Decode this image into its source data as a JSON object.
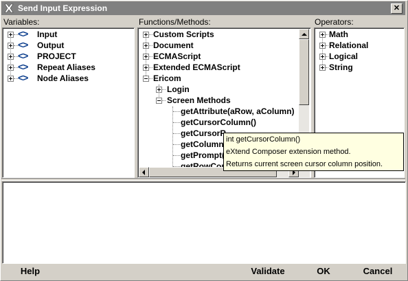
{
  "window": {
    "title": "Send Input Expression",
    "close_label": "✕"
  },
  "variables": {
    "label": "Variables:",
    "items": [
      {
        "icon": "<>",
        "label": "Input"
      },
      {
        "icon": "<>",
        "label": "Output"
      },
      {
        "icon": "<>",
        "label": "PROJECT"
      },
      {
        "icon": "<>",
        "label": "Repeat Aliases"
      },
      {
        "icon": "<>",
        "label": "Node Aliases"
      }
    ]
  },
  "functions": {
    "label": "Functions/Methods:",
    "items": [
      {
        "label": "Custom Scripts",
        "expanded": false
      },
      {
        "label": "Document",
        "expanded": false
      },
      {
        "label": "ECMAScript",
        "expanded": false
      },
      {
        "label": "Extended ECMAScript",
        "expanded": false
      },
      {
        "label": "Ericom",
        "expanded": true
      },
      {
        "label": "Login",
        "expanded": false
      },
      {
        "label": "Screen Methods",
        "expanded": true
      }
    ],
    "methods": [
      "getAttribute(aRow, aColumn)",
      "getCursorColumn()",
      "getCursorR",
      "getColumn",
      "getPrompt(",
      "getRowCou"
    ]
  },
  "operators": {
    "label": "Operators:",
    "items": [
      "Math",
      "Relational",
      "Logical",
      "String"
    ]
  },
  "tooltip": {
    "line1": "int getCursorColumn()",
    "line2": "eXtend Composer extension method.",
    "line3": "Returns current screen cursor column position."
  },
  "buttons": {
    "help": "Help",
    "validate": "Validate",
    "ok": "OK",
    "cancel": "Cancel"
  },
  "colors": {
    "title_bar": "#808080",
    "tooltip_bg": "#ffffe1",
    "alias_icon": "#0a3c8c",
    "dialog_bg": "#d4d0c8"
  }
}
